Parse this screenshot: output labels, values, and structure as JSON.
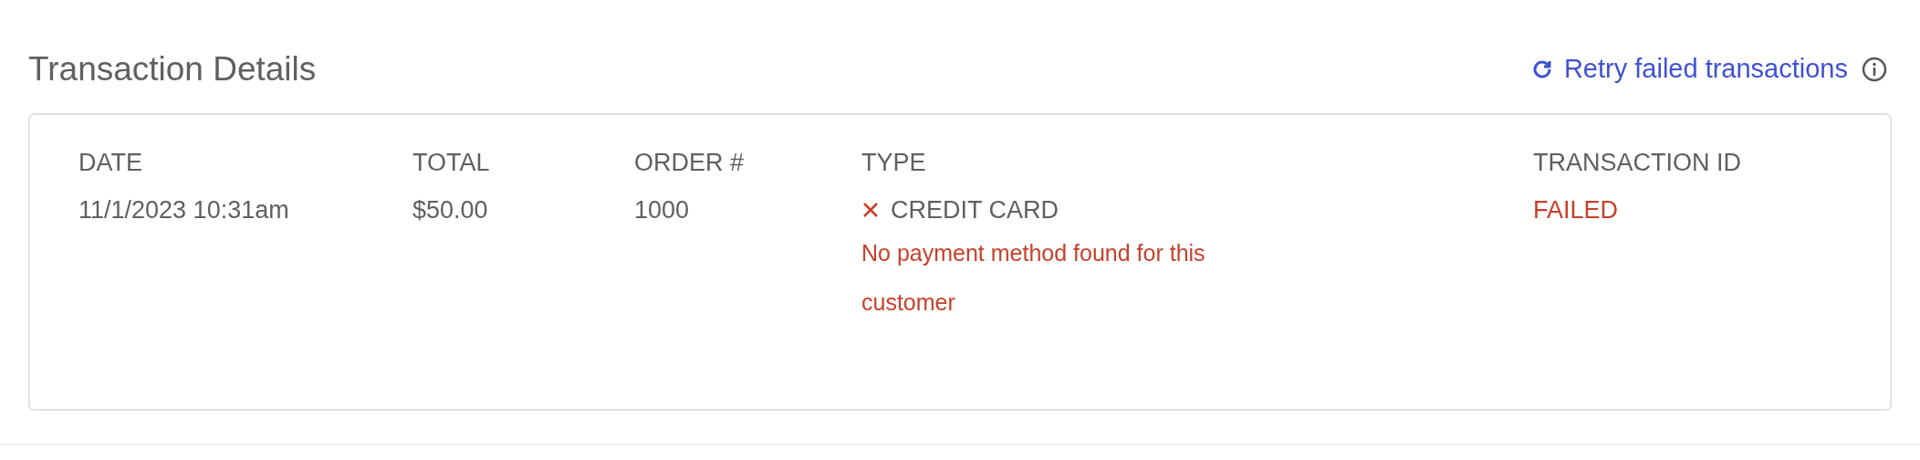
{
  "title": "Transaction Details",
  "retry_link": {
    "label": "Retry failed transactions"
  },
  "table": {
    "columns": [
      "DATE",
      "TOTAL",
      "ORDER #",
      "TYPE",
      "TRANSACTION ID"
    ],
    "rows": [
      {
        "date": "11/1/2023 10:31am",
        "total": "$50.00",
        "order": "1000",
        "type": "CREDIT CARD",
        "failed": true,
        "error": "No payment method found for this customer",
        "transaction_id": "FAILED"
      }
    ]
  }
}
